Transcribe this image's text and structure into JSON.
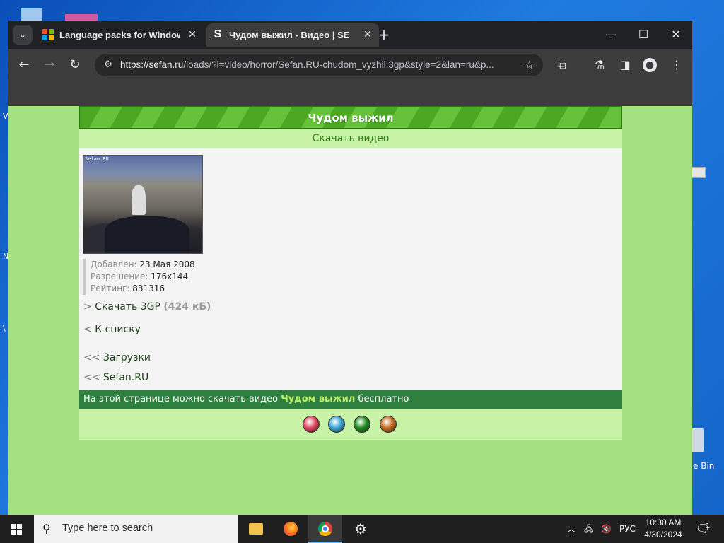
{
  "desktop": {
    "recycle_label": "e Bin",
    "edge_letters": [
      "V",
      "N",
      "\\"
    ]
  },
  "browser": {
    "tabs": [
      {
        "title": "Language packs for Windows -",
        "favicon": "windows-logo-icon",
        "active": false
      },
      {
        "title": "Чудом выжил - Видео | SEfan",
        "favicon": "sefan-s-icon",
        "active": true
      }
    ],
    "new_tab": "+",
    "url_host": "https://sefan.ru",
    "url_path": "/loads/?l=video/horror/Sefan.RU-chudom_vyzhil.3gp&style=2&lan=ru&p...",
    "icons": {
      "back": "←",
      "forward": "→",
      "reload": "↻",
      "star": "☆",
      "extensions": "⧉",
      "labs": "⚗",
      "sidepanel": "◨",
      "profile": "●",
      "menu": "⋮",
      "minimize": "—",
      "maximize": "☐",
      "close": "✕",
      "tab_search": "⌄",
      "tab_close": "✕"
    }
  },
  "page": {
    "header_title": "Чудом выжил",
    "subheader_link": "Скачать видео",
    "thumb_watermark": "Sefan.RU",
    "meta": [
      {
        "label": "Добавлен:",
        "value": "23 Мая 2008"
      },
      {
        "label": "Разрешение:",
        "value": "176x144"
      },
      {
        "label": "Рейтинг:",
        "value": "831316"
      }
    ],
    "download": {
      "arrow": ">",
      "label": "Скачать 3GP",
      "size": "(424 кБ)"
    },
    "back_to_list": {
      "arrow": "<",
      "label": "К списку"
    },
    "downloads_link": {
      "arrow": "<<",
      "label": "Загрузки"
    },
    "home_link": {
      "arrow": "<<",
      "label": "Sefan.RU"
    },
    "footer": {
      "prefix": "На этой странице можно скачать видео",
      "highlight": "Чудом выжил",
      "suffix": "бесплатно"
    },
    "style_balls": [
      "#e0455f",
      "#3aa8d8",
      "#1e8a1e",
      "#c86a20"
    ]
  },
  "taskbar": {
    "search_placeholder": "Type here to search",
    "language": "РУС",
    "time": "10:30 AM",
    "date": "4/30/2024",
    "notification_count": "1"
  }
}
